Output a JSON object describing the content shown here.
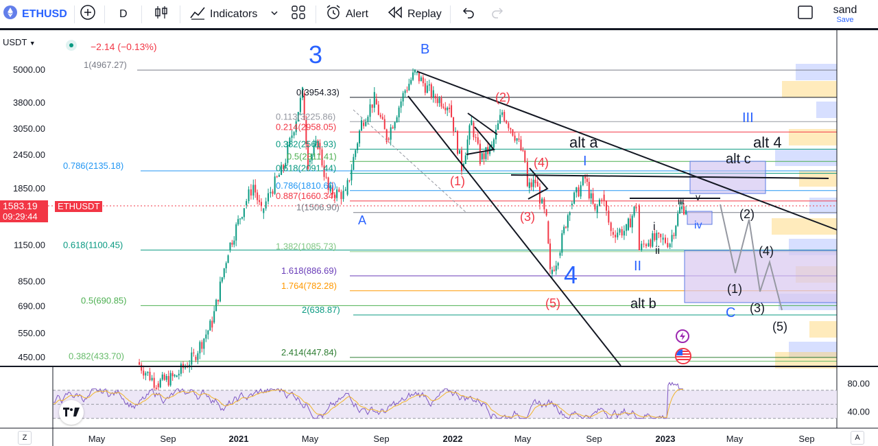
{
  "toolbar": {
    "symbol": "ETHUSD",
    "add_symbol_icon": "plus-circle-icon",
    "interval": "D",
    "chart_type_icon": "candles-icon",
    "indicators_label": "Indicators",
    "templates_icon": "grid-icon",
    "alert_label": "Alert",
    "replay_label": "Replay",
    "undo_icon": "undo-icon",
    "redo_icon": "redo-icon",
    "layout_icon": "square-icon",
    "user_name": "sand",
    "save_label": "Save"
  },
  "header": {
    "currency": "USDT",
    "change": "−2.14 (−0.13%)"
  },
  "price_tag": {
    "value": "1583.19",
    "countdown": "09:29:44",
    "symbol": "ETHUSDT"
  },
  "colors": {
    "price_red": "#f23645",
    "wave_blue": "#2962ff",
    "ethusdt_tag": "#f23645"
  },
  "chart_data": [
    {
      "type": "candlestick",
      "symbol": "ETHUSDT",
      "scale": "log",
      "ylim": [
        400,
        6000
      ],
      "y_ticks": [
        5000,
        3800,
        3050,
        2450,
        1850,
        1150,
        850,
        690,
        550,
        450
      ],
      "y_tick_labels": [
        "5000.00",
        "3800.00",
        "3050.00",
        "2450.00",
        "1850.00",
        "1150.00",
        "850.00",
        "690.00",
        "550.00",
        "450.00"
      ],
      "x_tick_labels": [
        "May",
        "Sep",
        "2021",
        "May",
        "Sep",
        "2022",
        "May",
        "Sep",
        "2023",
        "May",
        "Sep"
      ],
      "price_path": [
        [
          "2020-08-15",
          430
        ],
        [
          "2020-09-15",
          360
        ],
        [
          "2020-10-15",
          380
        ],
        [
          "2020-11-15",
          450
        ],
        [
          "2020-12-15",
          600
        ],
        [
          "2021-01-10",
          1100
        ],
        [
          "2021-02-05",
          1600
        ],
        [
          "2021-02-20",
          1900
        ],
        [
          "2021-03-05",
          1500
        ],
        [
          "2021-03-20",
          1800
        ],
        [
          "2021-04-10",
          2200
        ],
        [
          "2021-05-11",
          4100
        ],
        [
          "2021-05-20",
          2300
        ],
        [
          "2021-06-05",
          2700
        ],
        [
          "2021-06-22",
          1800
        ],
        [
          "2021-07-20",
          1750
        ],
        [
          "2021-08-15",
          3200
        ],
        [
          "2021-09-05",
          3900
        ],
        [
          "2021-09-25",
          2800
        ],
        [
          "2021-10-25",
          4200
        ],
        [
          "2021-11-10",
          4850
        ],
        [
          "2021-12-10",
          4000
        ],
        [
          "2022-01-05",
          3700
        ],
        [
          "2022-01-25",
          2200
        ],
        [
          "2022-02-10",
          3200
        ],
        [
          "2022-02-24",
          2350
        ],
        [
          "2022-03-15",
          2600
        ],
        [
          "2022-04-01",
          3500
        ],
        [
          "2022-04-25",
          2800
        ],
        [
          "2022-05-08",
          2300
        ],
        [
          "2022-05-12",
          1850
        ],
        [
          "2022-05-25",
          1950
        ],
        [
          "2022-06-12",
          1400
        ],
        [
          "2022-06-18",
          900
        ],
        [
          "2022-07-01",
          1050
        ],
        [
          "2022-07-20",
          1600
        ],
        [
          "2022-08-14",
          2000
        ],
        [
          "2022-08-30",
          1500
        ],
        [
          "2022-09-10",
          1750
        ],
        [
          "2022-09-25",
          1280
        ],
        [
          "2022-10-20",
          1300
        ],
        [
          "2022-11-05",
          1600
        ],
        [
          "2022-11-10",
          1100
        ],
        [
          "2022-11-25",
          1200
        ],
        [
          "2022-12-15",
          1200
        ],
        [
          "2022-12-30",
          1180
        ],
        [
          "2023-01-15",
          1550
        ],
        [
          "2023-01-25",
          1583
        ]
      ],
      "fib_levels": [
        {
          "label": "1(4967.27)",
          "value": 4967.27,
          "color": "#787b86"
        },
        {
          "label": "0(3954.33)",
          "value": 3954.33,
          "color": "#131722"
        },
        {
          "label": "0.113(3225.86)",
          "value": 3225.86,
          "color": "#9598a1"
        },
        {
          "label": "0.214(2958.05)",
          "value": 2958.05,
          "color": "#f23645"
        },
        {
          "label": "0.382(2561.93)",
          "value": 2561.93,
          "color": "#089981"
        },
        {
          "label": "0.5(2311.41)",
          "value": 2311.41,
          "color": "#4caf50"
        },
        {
          "label": "0.786(2135.18)",
          "value": 2135.18,
          "color": "#2196f3"
        },
        {
          "label": "0.618(2091.44)",
          "value": 2091.44,
          "color": "#089981"
        },
        {
          "label": "0.786(1810.60)",
          "value": 1810.6,
          "color": "#2196f3"
        },
        {
          "label": "0.887(1660.34)",
          "value": 1660.34,
          "color": "#f23645"
        },
        {
          "label": "1(1506.90)",
          "value": 1506.9,
          "color": "#787b86"
        },
        {
          "label": "0.618(1100.45)",
          "value": 1100.45,
          "color": "#089981"
        },
        {
          "label": "1.382(1085.73)",
          "value": 1085.73,
          "color": "#81c784"
        },
        {
          "label": "1.618(886.69)",
          "value": 886.69,
          "color": "#673ab7"
        },
        {
          "label": "1.764(782.28)",
          "value": 782.28,
          "color": "#ff9800"
        },
        {
          "label": "0.5(690.85)",
          "value": 690.85,
          "color": "#4caf50"
        },
        {
          "label": "2(638.87)",
          "value": 638.87,
          "color": "#089981"
        },
        {
          "label": "0.382(433.70)",
          "value": 433.7,
          "color": "#66bb6a"
        },
        {
          "label": "2.414(447.84)",
          "value": 447.84,
          "color": "#2e7d32"
        }
      ],
      "wave_labels": [
        {
          "text": "3",
          "color": "#2962ff"
        },
        {
          "text": "B",
          "color": "#2962ff"
        },
        {
          "text": "A",
          "color": "#2962ff"
        },
        {
          "text": "(1)",
          "color": "#f23645"
        },
        {
          "text": "(2)",
          "color": "#f23645"
        },
        {
          "text": "(3)",
          "color": "#f23645"
        },
        {
          "text": "(4)",
          "color": "#f23645"
        },
        {
          "text": "(5)",
          "color": "#f23645"
        },
        {
          "text": "4",
          "color": "#2962ff"
        },
        {
          "text": "alt a",
          "color": "#131722"
        },
        {
          "text": "I",
          "color": "#2962ff"
        },
        {
          "text": "II",
          "color": "#2962ff"
        },
        {
          "text": "III",
          "color": "#2962ff"
        },
        {
          "text": "alt 4",
          "color": "#131722"
        },
        {
          "text": "alt c",
          "color": "#131722"
        },
        {
          "text": "alt b",
          "color": "#131722"
        },
        {
          "text": "i",
          "color": "#131722"
        },
        {
          "text": "ii",
          "color": "#131722"
        },
        {
          "text": "iii",
          "color": "#131722"
        },
        {
          "text": "iv",
          "color": "#2962ff"
        },
        {
          "text": "v",
          "color": "#131722"
        },
        {
          "text": "(1)",
          "color": "#131722"
        },
        {
          "text": "(2)",
          "color": "#131722"
        },
        {
          "text": "(3)",
          "color": "#131722"
        },
        {
          "text": "(4)",
          "color": "#131722"
        },
        {
          "text": "(5)",
          "color": "#131722"
        },
        {
          "text": "C",
          "color": "#2962ff"
        }
      ]
    },
    {
      "type": "line",
      "name": "",
      "ylim": [
        20,
        100
      ],
      "y_ticks": [
        80,
        40
      ],
      "y_tick_labels": [
        "80.00",
        "40.00"
      ],
      "bands": [
        70,
        30
      ]
    }
  ]
}
